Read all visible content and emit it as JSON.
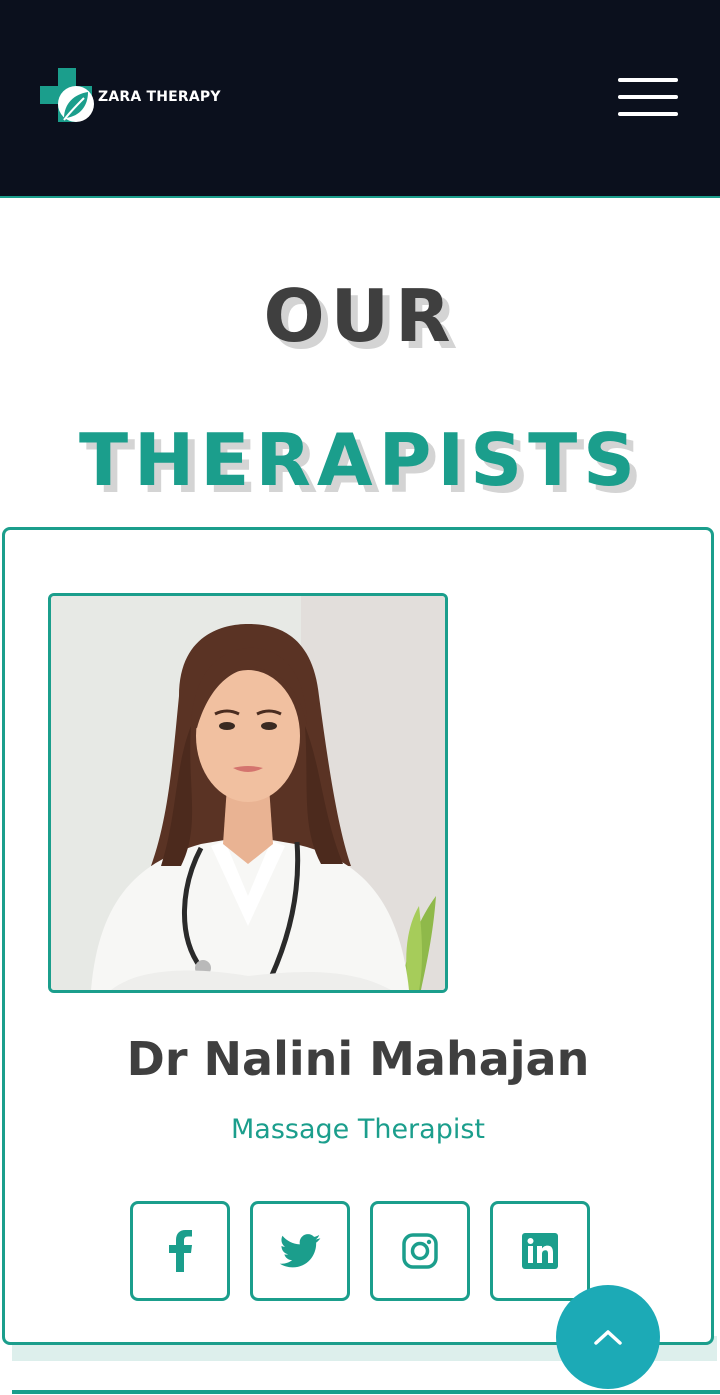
{
  "header": {
    "brand_name": "ZARA THERAPY",
    "logo_icon": "medical-cross-leaf-icon",
    "menu_icon": "hamburger-menu-icon"
  },
  "section": {
    "title_line1": "OUR",
    "title_line2": "THERAPISTS"
  },
  "therapist": {
    "name": "Dr Nalini Mahajan",
    "role": "Massage Therapist",
    "photo_description": "portrait of therapist in white coat with stethoscope",
    "social_links": [
      {
        "network": "Facebook",
        "icon": "facebook-icon"
      },
      {
        "network": "Twitter",
        "icon": "twitter-icon"
      },
      {
        "network": "Instagram",
        "icon": "instagram-icon"
      },
      {
        "network": "LinkedIn",
        "icon": "linkedin-icon"
      }
    ]
  },
  "scroll_top": {
    "icon": "chevron-up-icon"
  },
  "colors": {
    "header_bg": "#0b101d",
    "accent": "#1b9e8c",
    "heading_dark": "#3f3f3f",
    "scroll_top_bg": "#1caab6"
  }
}
